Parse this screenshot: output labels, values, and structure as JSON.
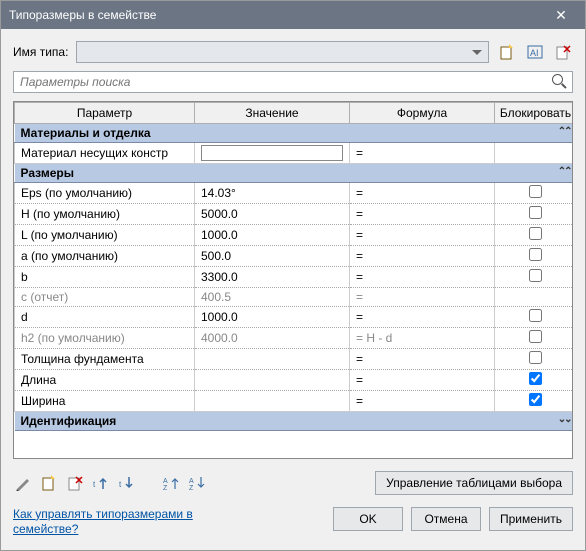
{
  "window": {
    "title": "Типоразмеры в семействе"
  },
  "name_row": {
    "label": "Имя типа:"
  },
  "search": {
    "placeholder": "Параметры поиска"
  },
  "columns": {
    "param": "Параметр",
    "value": "Значение",
    "formula": "Формула",
    "lock": "Блокировать"
  },
  "groups": {
    "materials": {
      "title": "Материалы и отделка"
    },
    "dimensions": {
      "title": "Размеры"
    },
    "identification": {
      "title": "Идентификация"
    }
  },
  "rows": {
    "material": {
      "label": "Материал несущих констр",
      "value": "",
      "formula": "="
    },
    "eps": {
      "label": "Eps (по умолчанию)",
      "value": "14.03°",
      "formula": "="
    },
    "h_upper": {
      "label": "H (по умолчанию)",
      "value": "5000.0",
      "formula": "="
    },
    "l_upper": {
      "label": "L (по умолчанию)",
      "value": "1000.0",
      "formula": "="
    },
    "a_lower": {
      "label": "a (по умолчанию)",
      "value": "500.0",
      "formula": "="
    },
    "b_lower": {
      "label": "b",
      "value": "3300.0",
      "formula": "="
    },
    "c_report": {
      "label": "c (отчет)",
      "value": "400.5",
      "formula": "="
    },
    "d_lower": {
      "label": "d",
      "value": "1000.0",
      "formula": "="
    },
    "h2": {
      "label": "h2 (по умолчанию)",
      "value": "4000.0",
      "formula": "= H - d"
    },
    "thickness": {
      "label": "Толщина фундамента",
      "value": "",
      "formula": "="
    },
    "length": {
      "label": "Длина",
      "value": "",
      "formula": "=",
      "locked": true
    },
    "width": {
      "label": "Ширина",
      "value": "",
      "formula": "=",
      "locked": true
    }
  },
  "toolbar": {
    "manage_tables": "Управление таблицами выбора"
  },
  "help_link": "Как управлять типоразмерами в семействе?",
  "buttons": {
    "ok": "OK",
    "cancel": "Отмена",
    "apply": "Применить"
  }
}
